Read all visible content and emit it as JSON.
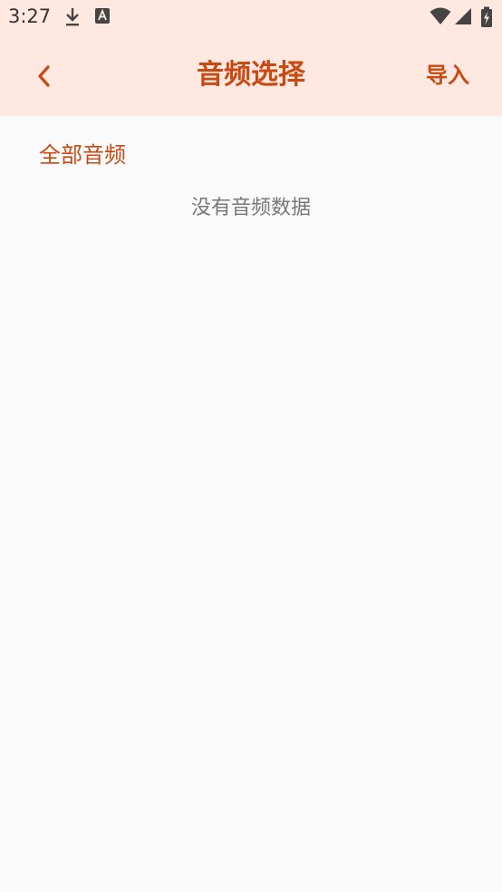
{
  "status_bar": {
    "time": "3:27",
    "icons": [
      "download-icon",
      "text-a-icon",
      "wifi-icon",
      "signal-icon",
      "battery-charging-icon"
    ]
  },
  "app_bar": {
    "back_icon": "chevron-left-icon",
    "title": "音频选择",
    "import_label": "导入"
  },
  "content": {
    "section_label": "全部音频",
    "empty_message": "没有音频数据"
  },
  "colors": {
    "accent": "#c84a12",
    "header_bg": "#ffe8df",
    "page_bg": "#fafafa",
    "muted_text": "#777777"
  }
}
